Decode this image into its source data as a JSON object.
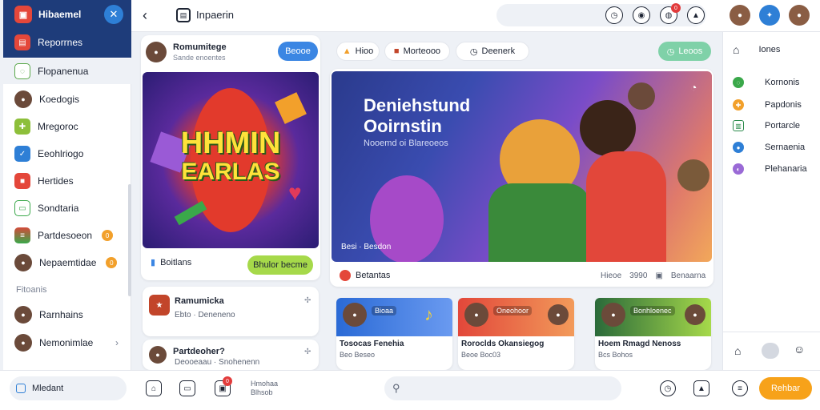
{
  "sidebar": {
    "brand": "Hibaemel",
    "top_item": "Reporrnes",
    "items": [
      {
        "label": "Flopanenua",
        "icon": "chat-bubble-icon",
        "color": "#5aa84a"
      },
      {
        "label": "Koedogis",
        "icon": "avatar",
        "color": "#6b4a3a"
      },
      {
        "label": "Mregoroc",
        "icon": "gamepad-icon",
        "color": "#8dbf3a"
      },
      {
        "label": "Eeohlriogo",
        "icon": "checkbox-icon",
        "color": "#2e7fd6"
      },
      {
        "label": "Hertides",
        "icon": "badge-icon",
        "color": "#e4473a"
      },
      {
        "label": "Sondtaria",
        "icon": "message-icon",
        "color": "#3aa84a"
      },
      {
        "label": "Partdesoeon",
        "icon": "stack-icon",
        "color": "#d44a3a",
        "badge": "0"
      },
      {
        "label": "Nepaemtidae",
        "icon": "avatar",
        "color": "#6b4a3a",
        "badge": "0"
      }
    ],
    "section_label": "Fitoanis",
    "section_items": [
      {
        "label": "Rarnhains"
      },
      {
        "label": "Nemonimlae"
      }
    ]
  },
  "topbar": {
    "page_title": "Inpaerin",
    "notif_count": "0"
  },
  "post": {
    "author": "Romumitege",
    "subtitle": "Sande enoentes",
    "follow_label": "Beooe",
    "game_title_line1": "HHMIN",
    "game_title_line2": "EARLAS",
    "footer_label": "Boitlans",
    "cta_label": "Bhulor becme"
  },
  "side_cards": [
    {
      "title": "Ramumicka",
      "meta": "Ebto · Deneneno"
    },
    {
      "title": "Partdeoher?",
      "meta": "Deooeaau · Snohenenn"
    }
  ],
  "filters": [
    {
      "label": "Hioo",
      "icon": "flame-icon"
    },
    {
      "label": "Morteooo",
      "icon": "badge-icon"
    },
    {
      "label": "Deenerk",
      "icon": "clock-icon"
    }
  ],
  "filter_action": "Leoos",
  "banner": {
    "title_line1": "Deniehstund",
    "title_line2": "Ooirnstin",
    "subtitle": "Nooemd oi Blareoeos",
    "stats": "Besi · Besdon",
    "footer_title": "Betantas",
    "footer_meta1": "Hieoe",
    "footer_meta2": "3990",
    "footer_meta3": "Benaarna"
  },
  "mini_cards": [
    {
      "title": "Tosocas Fenehia",
      "meta": "Beo Beseo",
      "tag": "Bioaa",
      "c1": "#2a6ad6",
      "c2": "#6a9af0"
    },
    {
      "title": "Roroclds Okansiegog",
      "meta": "Beoe Boc03",
      "tag": "Oneohoor",
      "c1": "#e2473a",
      "c2": "#f29a5a"
    },
    {
      "title": "Hoem Rmagd Nenoss",
      "meta": "Bcs Bohos",
      "tag": "Bonhloenec",
      "c1": "#2a6a3a",
      "c2": "#a6d94a"
    }
  ],
  "rightpanel": {
    "top_label": "Iones",
    "items": [
      {
        "label": "Kornonis",
        "color": "#3aa84a"
      },
      {
        "label": "Papdonis",
        "color": "#f2a02b"
      },
      {
        "label": "Portarcle",
        "color": "#2a8a4a"
      },
      {
        "label": "Sernaenia",
        "color": "#2e7fd6"
      },
      {
        "label": "Plehanaria",
        "color": "#9a6ad6"
      }
    ]
  },
  "bottombar": {
    "search_placeholder": "Mledant",
    "mini_label_1": "Hmohaa",
    "mini_label_2": "Blhsob",
    "notif_count": "0",
    "cta_label": "Rehbar"
  }
}
